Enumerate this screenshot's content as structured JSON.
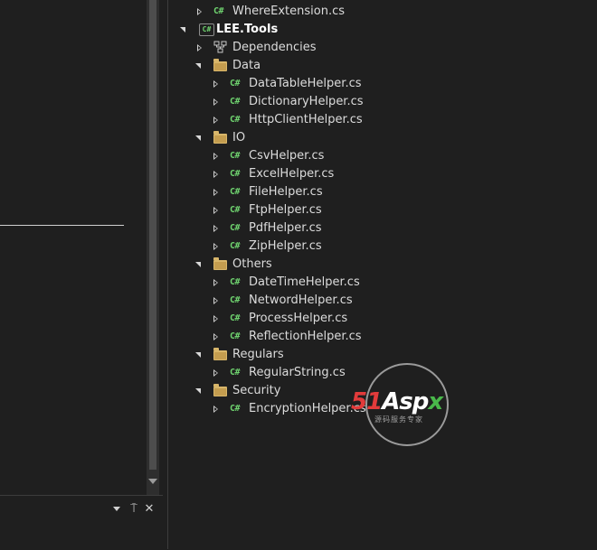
{
  "tree": {
    "rows": [
      {
        "id": "where-extension",
        "label": "WhereExtension.cs",
        "kind": "cs",
        "state": "collapsed",
        "level": 1
      },
      {
        "id": "project-lee-tools",
        "label": "LEE.Tools",
        "kind": "project",
        "state": "expanded",
        "level": 0
      },
      {
        "id": "dependencies",
        "label": "Dependencies",
        "kind": "dependencies",
        "state": "collapsed",
        "level": 1
      },
      {
        "id": "folder-data",
        "label": "Data",
        "kind": "folder",
        "state": "expanded",
        "level": 1
      },
      {
        "id": "datatable-helper",
        "label": "DataTableHelper.cs",
        "kind": "cs",
        "state": "collapsed",
        "level": 2
      },
      {
        "id": "dictionary-helper",
        "label": "DictionaryHelper.cs",
        "kind": "cs",
        "state": "collapsed",
        "level": 2
      },
      {
        "id": "httpclient-helper",
        "label": "HttpClientHelper.cs",
        "kind": "cs",
        "state": "collapsed",
        "level": 2
      },
      {
        "id": "folder-io",
        "label": "IO",
        "kind": "folder",
        "state": "expanded",
        "level": 1
      },
      {
        "id": "csv-helper",
        "label": "CsvHelper.cs",
        "kind": "cs",
        "state": "collapsed",
        "level": 2
      },
      {
        "id": "excel-helper",
        "label": "ExcelHelper.cs",
        "kind": "cs",
        "state": "collapsed",
        "level": 2
      },
      {
        "id": "file-helper",
        "label": "FileHelper.cs",
        "kind": "cs",
        "state": "collapsed",
        "level": 2
      },
      {
        "id": "ftp-helper",
        "label": "FtpHelper.cs",
        "kind": "cs",
        "state": "collapsed",
        "level": 2
      },
      {
        "id": "pdf-helper",
        "label": "PdfHelper.cs",
        "kind": "cs",
        "state": "collapsed",
        "level": 2
      },
      {
        "id": "zip-helper",
        "label": "ZipHelper.cs",
        "kind": "cs",
        "state": "collapsed",
        "level": 2
      },
      {
        "id": "folder-others",
        "label": "Others",
        "kind": "folder",
        "state": "expanded",
        "level": 1
      },
      {
        "id": "datetime-helper",
        "label": "DateTimeHelper.cs",
        "kind": "cs",
        "state": "collapsed",
        "level": 2
      },
      {
        "id": "netword-helper",
        "label": "NetwordHelper.cs",
        "kind": "cs",
        "state": "collapsed",
        "level": 2
      },
      {
        "id": "process-helper",
        "label": "ProcessHelper.cs",
        "kind": "cs",
        "state": "collapsed",
        "level": 2
      },
      {
        "id": "reflection-helper",
        "label": "ReflectionHelper.cs",
        "kind": "cs",
        "state": "collapsed",
        "level": 2
      },
      {
        "id": "folder-regulars",
        "label": "Regulars",
        "kind": "folder",
        "state": "expanded",
        "level": 1
      },
      {
        "id": "regular-string",
        "label": "RegularString.cs",
        "kind": "cs",
        "state": "collapsed",
        "level": 2
      },
      {
        "id": "folder-security",
        "label": "Security",
        "kind": "folder",
        "state": "expanded",
        "level": 1
      },
      {
        "id": "encryption-helper",
        "label": "EncryptionHelper.cs",
        "kind": "cs",
        "state": "collapsed",
        "level": 2
      }
    ],
    "icon_glyphs": {
      "cs": "C#",
      "project": "C#"
    }
  },
  "panel": {
    "dropdown_icon": "chevron-down-icon",
    "pin_glyph": "⍑",
    "close_glyph": "✕"
  },
  "watermark": {
    "part1": "51",
    "part2": "Asp",
    "part3": "x",
    "subtitle": "源码服务专家"
  },
  "colors": {
    "background": "#1f1f1f",
    "cs_icon": "#6fd36f",
    "folder": "#d8b66a",
    "text": "#dcdcdc"
  }
}
